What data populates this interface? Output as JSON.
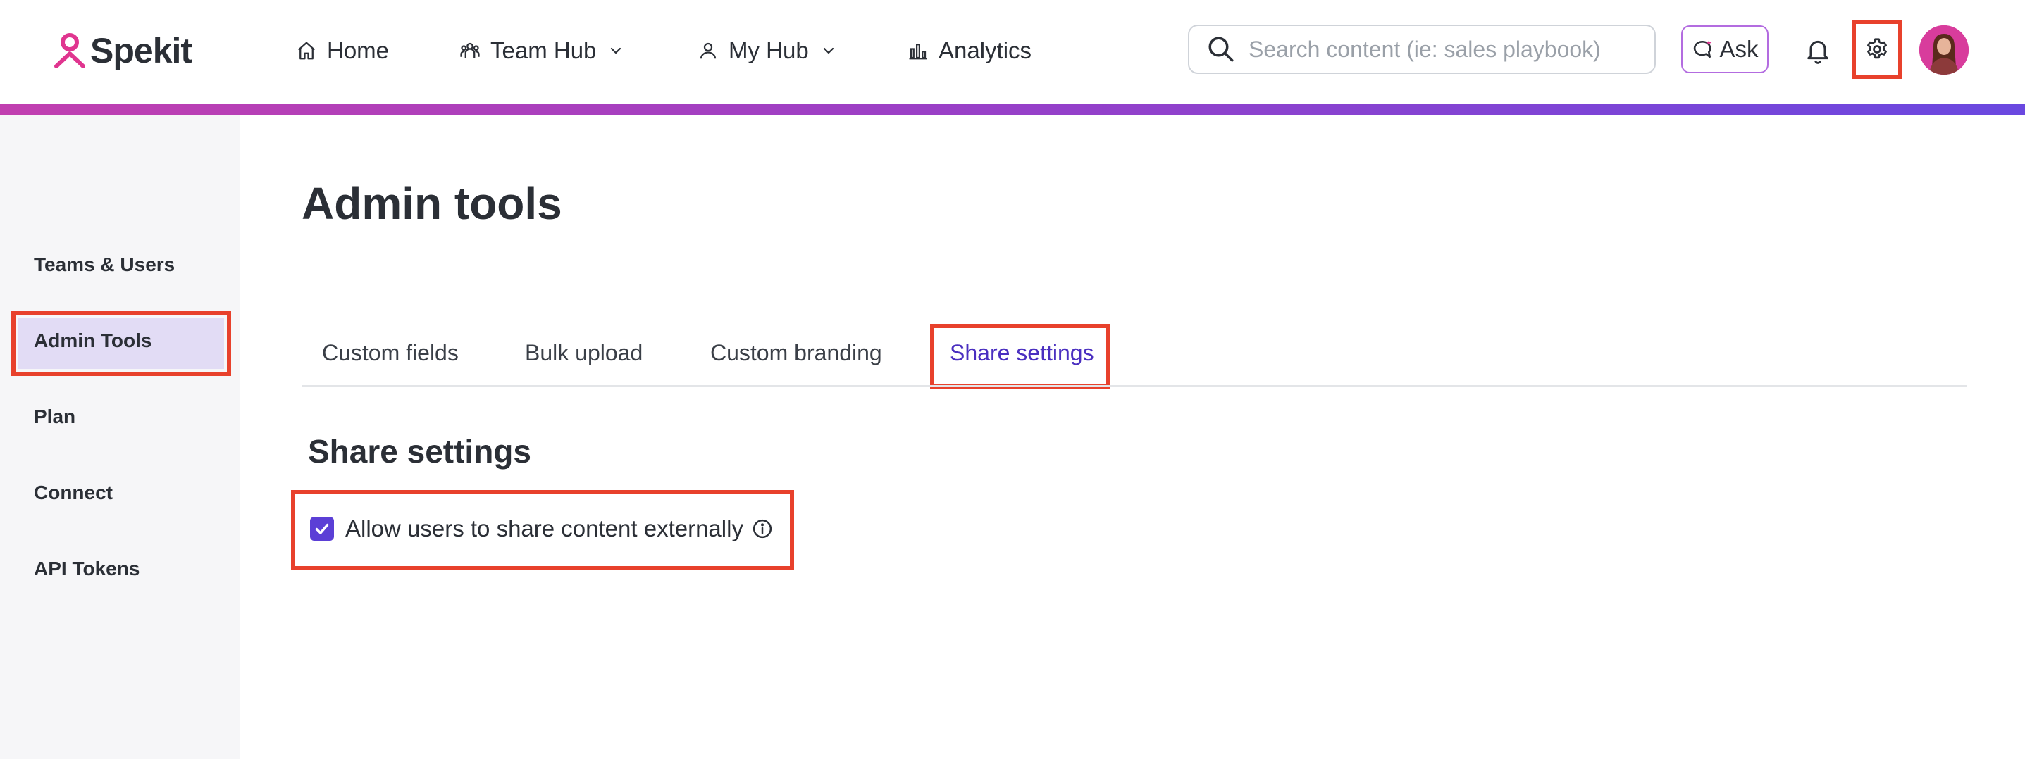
{
  "header": {
    "logo_text": "Spekit",
    "nav": {
      "home": "Home",
      "team_hub": "Team Hub",
      "my_hub": "My Hub",
      "analytics": "Analytics"
    },
    "search_placeholder": "Search content (ie: sales playbook)",
    "ask_label": "Ask",
    "icons": [
      "home-icon",
      "team-icon",
      "user-icon",
      "analytics-icon",
      "search-icon",
      "ask-icon",
      "bell-icon",
      "gear-icon",
      "avatar"
    ]
  },
  "sidebar": {
    "items": [
      {
        "label": "Teams & Users"
      },
      {
        "label": "Admin Tools",
        "active": true
      },
      {
        "label": "Plan"
      },
      {
        "label": "Connect"
      },
      {
        "label": "API Tokens"
      }
    ]
  },
  "main": {
    "title": "Admin tools",
    "tabs": [
      {
        "label": "Custom fields"
      },
      {
        "label": "Bulk upload"
      },
      {
        "label": "Custom branding"
      },
      {
        "label": "Share settings",
        "active": true
      }
    ],
    "section_title": "Share settings",
    "share_checkbox": {
      "label": "Allow users to share content externally",
      "checked": true
    }
  },
  "colors": {
    "accent": "#5b3fd6",
    "highlight": "#e8412c",
    "brand_pink": "#e0358f",
    "active_tab": "#4a2fc0",
    "sidebar_bg": "#f6f6f8",
    "sidebar_active_bg": "#e2dcf5"
  }
}
